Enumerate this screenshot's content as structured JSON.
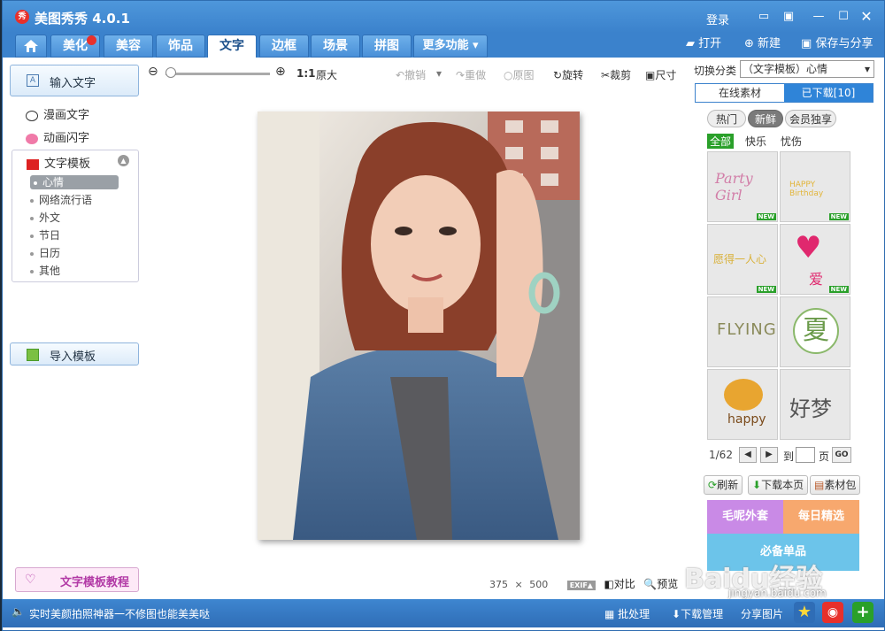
{
  "app": {
    "title": "美图秀秀 4.0.1",
    "logo_text": "秀"
  },
  "titlebar": {
    "login": "登录"
  },
  "tabs": [
    {
      "label": "美化",
      "badge": true
    },
    {
      "label": "美容"
    },
    {
      "label": "饰品"
    },
    {
      "label": "文字",
      "active": true
    },
    {
      "label": "边框"
    },
    {
      "label": "场景"
    },
    {
      "label": "拼图"
    },
    {
      "label": "更多功能 ▾"
    }
  ],
  "right_actions": {
    "open": "打开",
    "new": "新建",
    "save": "保存与分享"
  },
  "left_panel": {
    "input_text": "输入文字",
    "comic_text": "漫画文字",
    "anim_text": "动画闪字",
    "template_header": "文字模板",
    "template_items": [
      "心情",
      "网络流行语",
      "外文",
      "节日",
      "日历",
      "其他"
    ],
    "selected_item": "心情",
    "import_template": "导入模板",
    "tutorial": "文字模板教程"
  },
  "toolbar": {
    "zoom_ratio": "1:1",
    "original_size": "原大",
    "undo": "撤销",
    "redo": "重做",
    "original": "原图",
    "rotate": "旋转",
    "crop": "裁剪",
    "size": "尺寸"
  },
  "canvas_status": {
    "width": "375",
    "times": "×",
    "height": "500",
    "exif": "EXIF▲",
    "compare": "对比",
    "preview": "预览"
  },
  "right_panel": {
    "switch_label": "切换分类",
    "switch_value": "（文字模板）心情",
    "tab_online": "在线素材",
    "tab_downloaded": "已下载[10]",
    "filters": [
      "热门",
      "新鲜",
      "会员独享"
    ],
    "active_filter": "新鲜",
    "sub_filters": [
      "全部",
      "快乐",
      "忧伤"
    ],
    "thumbnails": [
      {
        "text": "Party Girl",
        "new": true
      },
      {
        "text": "HAPPY Birthday",
        "new": true
      },
      {
        "text": "愿得一人心",
        "new": true
      },
      {
        "text": "爱",
        "new": true
      },
      {
        "text": "FLYING",
        "new": false
      },
      {
        "text": "夏",
        "new": false
      },
      {
        "text": "happy",
        "new": false
      },
      {
        "text": "好梦",
        "new": false
      }
    ],
    "pager": {
      "current": "1/62",
      "goto": "到",
      "page": "页",
      "go": "GO"
    },
    "buttons": {
      "refresh": "刷新",
      "download_page": "下载本页",
      "material_pack": "素材包"
    },
    "banner": {
      "left": "毛呢外套",
      "right": "每日精选",
      "bottom": "必备单品"
    }
  },
  "bottombar": {
    "tip": "实时美颜拍照神器一不修图也能美美哒",
    "batch": "批处理",
    "download_manager": "下载管理",
    "share_pic": "分享图片"
  },
  "watermark": {
    "text1": "Baidu经验",
    "text2": "jingyan.baidu.com"
  }
}
